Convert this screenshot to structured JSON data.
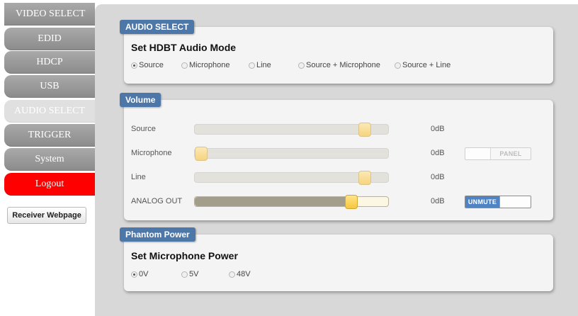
{
  "sidebar": {
    "items": [
      {
        "label": "VIDEO SELECT"
      },
      {
        "label": "EDID"
      },
      {
        "label": "HDCP"
      },
      {
        "label": "USB"
      },
      {
        "label": "AUDIO SELECT"
      },
      {
        "label": "TRIGGER"
      },
      {
        "label": "System"
      },
      {
        "label": "Logout"
      }
    ],
    "receiver_button": "Receiver Webpage"
  },
  "audio_select": {
    "tag": "AUDIO SELECT",
    "heading": "Set HDBT Audio Mode",
    "options": [
      "Source",
      "Microphone",
      "Line",
      "Source + Microphone",
      "Source + Line"
    ],
    "selected": "Source"
  },
  "volume": {
    "tag": "Volume",
    "rows": [
      {
        "label": "Source",
        "value": "0dB",
        "level": 0.88
      },
      {
        "label": "Microphone",
        "value": "0dB",
        "level": 0.0,
        "toggle": "PANEL"
      },
      {
        "label": "Line",
        "value": "0dB",
        "level": 0.88
      },
      {
        "label": "ANALOG OUT",
        "value": "0dB",
        "level": 0.81,
        "toggle": "UNMUTE"
      }
    ]
  },
  "phantom_power": {
    "tag": "Phantom Power",
    "heading": "Set Microphone Power",
    "options": [
      "0V",
      "5V",
      "48V"
    ],
    "selected": "0V"
  },
  "colors": {
    "panel_tag": "#4d77a8",
    "logout": "#ff0000",
    "active_tab": "#e0e0e0",
    "unmute_toggle": "#4f83c4"
  }
}
